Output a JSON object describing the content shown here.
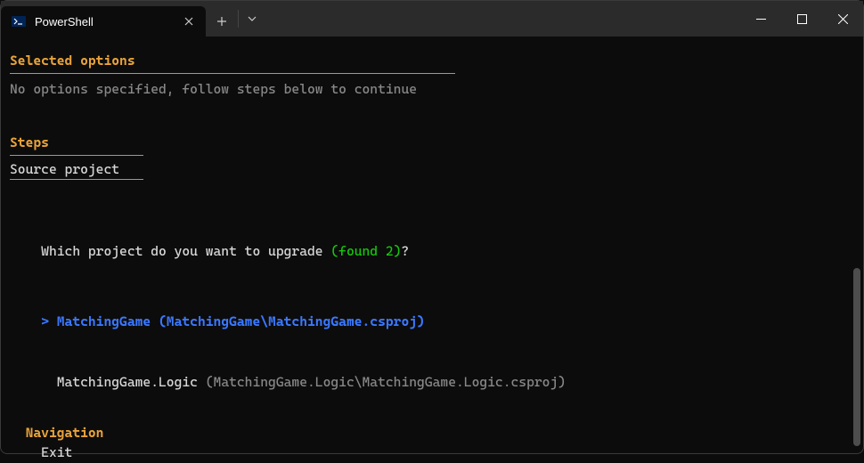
{
  "titlebar": {
    "tab_title": "PowerShell"
  },
  "terminal": {
    "selected_options_heading": "Selected options",
    "selected_options_body": "No options specified, follow steps below to continue",
    "steps_heading": "Steps",
    "steps_body": "Source project",
    "prompt_prefix": "Which project do you want to upgrade ",
    "prompt_found": "(found 2)",
    "prompt_suffix": "?",
    "option1_cursor": "> ",
    "option1_name": "MatchingGame ",
    "option1_path": "(MatchingGame\\MatchingGame.csproj)",
    "option2_indent": "  ",
    "option2_name": "MatchingGame.Logic ",
    "option2_path": "(MatchingGame.Logic\\MatchingGame.Logic.csproj)",
    "nav_heading": "  Navigation",
    "nav_exit": "    Exit"
  }
}
